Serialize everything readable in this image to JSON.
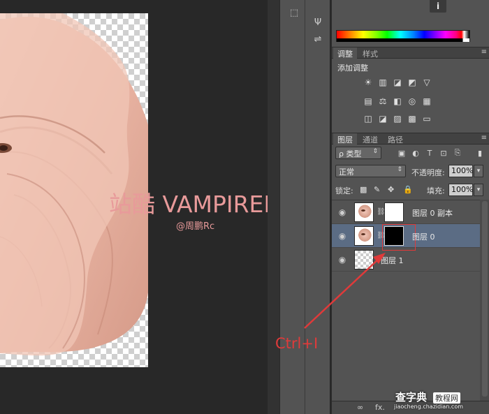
{
  "canvas": {
    "watermark_title": "站酷 VAMPIREE",
    "watermark_sub": "@周鹏Rc",
    "annotation": "Ctrl+I"
  },
  "dock": {
    "icons": [
      "cube-icon",
      "brush-tool-icon",
      "sliders-icon"
    ]
  },
  "color_panel": {
    "info_icon": "i"
  },
  "adjustments_panel": {
    "tabs": [
      "调整",
      "样式"
    ],
    "add_label": "添加调整",
    "row1": [
      "☀",
      "▥",
      "◪",
      "◩",
      "▽"
    ],
    "row2": [
      "▤",
      "⚖",
      "◧",
      "◎",
      "▦"
    ],
    "row3": [
      "◫",
      "◪",
      "▨",
      "▩",
      "▭"
    ]
  },
  "layers_panel": {
    "tabs": [
      "图层",
      "通道",
      "路径"
    ],
    "filter_label": "ρ 类型",
    "blend_mode": "正常",
    "opacity_label": "不透明度:",
    "opacity_value": "100%",
    "lock_label": "锁定:",
    "fill_label": "填充:",
    "fill_value": "100%",
    "layers": [
      {
        "name": "图层 0 副本",
        "selected": false,
        "mask": "white"
      },
      {
        "name": "图层 0",
        "selected": true,
        "mask": "black"
      },
      {
        "name": "图层 1",
        "selected": false,
        "mask": "none"
      }
    ],
    "bottom_icons": [
      "∞",
      "fx."
    ]
  },
  "site_watermark": {
    "big": "查字典",
    "tag": "教程网",
    "small": "jiaocheng.chazidian.com"
  },
  "accent": "#e03a3a",
  "selection_color": "#5b6c84"
}
